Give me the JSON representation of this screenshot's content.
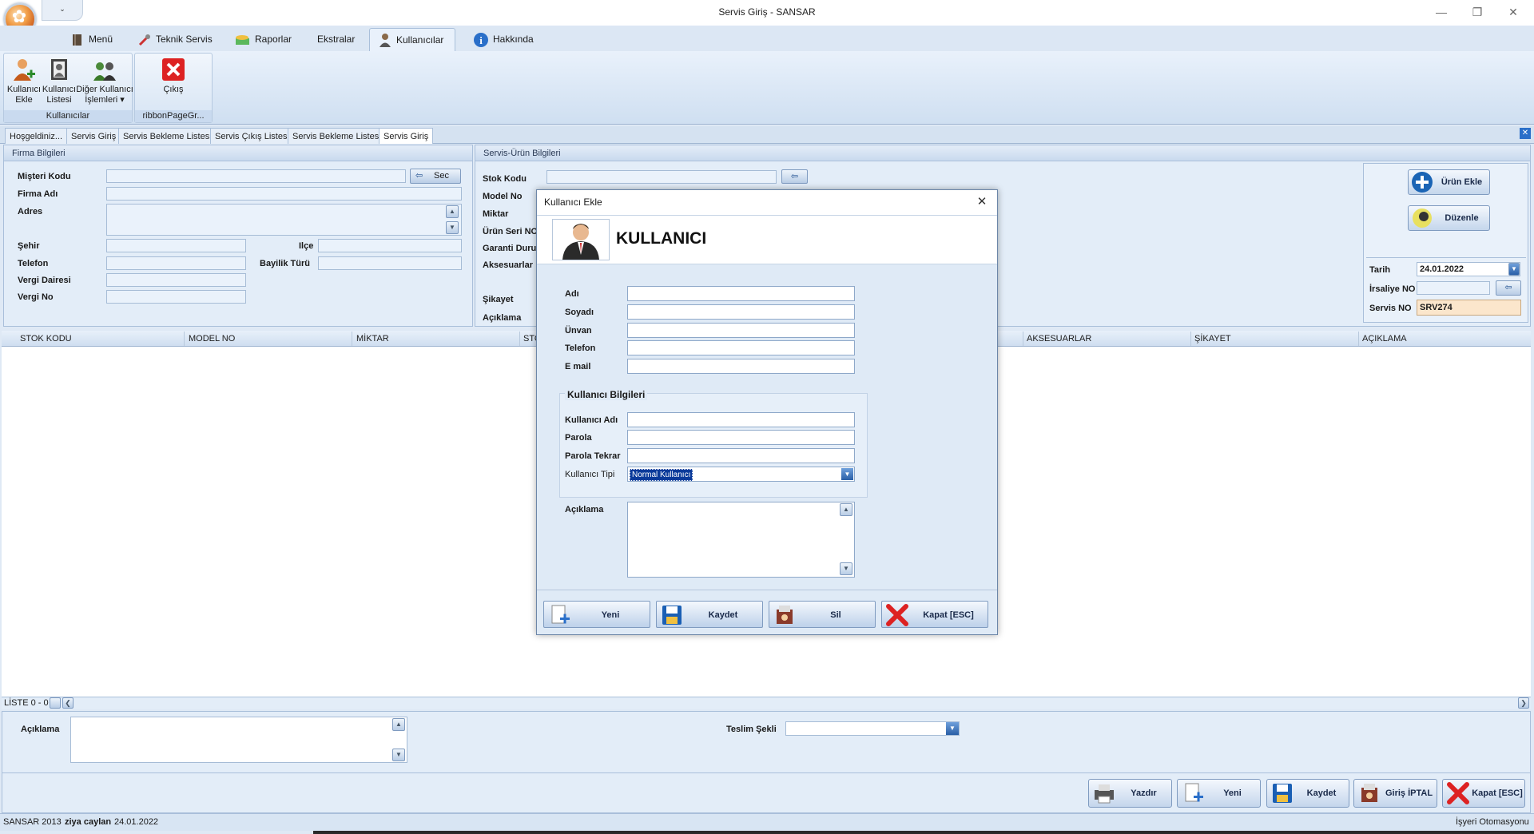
{
  "window": {
    "title": "Servis Giriş - SANSAR",
    "qat_label": "⌄"
  },
  "tabs": [
    {
      "label": "Menü",
      "icon": "book-icon"
    },
    {
      "label": "Teknik Servis",
      "icon": "tools-icon"
    },
    {
      "label": "Raporlar",
      "icon": "money-icon"
    },
    {
      "label": "Ekstralar",
      "icon": ""
    },
    {
      "label": "Kullanıcılar",
      "icon": "user-icon",
      "active": true
    },
    {
      "label": "Hakkında",
      "icon": "info-icon"
    }
  ],
  "ribbon": {
    "group1": {
      "label": "Kullanıcılar",
      "buttons": [
        {
          "line1": "Kullanıcı",
          "line2": "Ekle"
        },
        {
          "line1": "Kullanıcı",
          "line2": "Listesi"
        },
        {
          "line1": "Diğer Kullanıcı",
          "line2": "İşlemleri ▾"
        }
      ]
    },
    "group2": {
      "label": "ribbonPageGr...",
      "buttons": [
        {
          "line1": "Çıkış"
        }
      ]
    }
  },
  "doc_tabs": [
    "Hoşgeldiniz...",
    "Servis Giriş",
    "Servis Bekleme Listesi",
    "Servis Çıkış Listesi",
    "Servis Bekleme Listesi",
    "Servis Giriş"
  ],
  "firma": {
    "header": "Firma Bilgileri",
    "musteri_kodu": "Mişteri Kodu",
    "sec_button": "Sec",
    "firma_adi": "Firma Adı",
    "adres": "Adres",
    "sehir": "Şehir",
    "ilce": "Ilçe",
    "telefon": "Telefon",
    "bayilik_turu": "Bayilik Türü",
    "vergi_dairesi": "Vergi Dairesi",
    "vergi_no": "Vergi No"
  },
  "urun": {
    "header": "Servis-Ürün Bilgileri",
    "stok_kodu": "Stok Kodu",
    "model_no": "Model No",
    "miktar": "Miktar",
    "urun_seri_no": "Ürün Seri NO",
    "garanti": "Garanti Durum",
    "aksesuarlar": "Aksesuarlar",
    "sikayet": "Şikayet",
    "aciklama": "Açıklama"
  },
  "side": {
    "urun_ekle": "Ürün Ekle",
    "duzenle": "Düzenle",
    "tarih_label": "Tarih",
    "tarih_value": "24.01.2022",
    "irsaliye_label": "İrsaliye NO",
    "servis_label": "Servis NO",
    "servis_value": "SRV274"
  },
  "grid": {
    "columns": [
      "STOK KODU",
      "MODEL NO",
      "MİKTAR",
      "STO",
      "AKSESUARLAR",
      "ŞİKAYET",
      "AÇIKLAMA"
    ],
    "list_status": "LİSTE 0 - 0"
  },
  "bottom": {
    "aciklama": "Açıklama",
    "teslim": "Teslim Şekli",
    "buttons": [
      "Yazdır",
      "Yeni",
      "Kaydet",
      "Giriş İPTAL",
      "Kapat [ESC]"
    ]
  },
  "status": {
    "app": "SANSAR 2013",
    "user": "ziya caylan",
    "date": "24.01.2022",
    "right": "İşyeri Otomasyonu"
  },
  "dialog": {
    "title": "Kullanıcı Ekle",
    "heading": "KULLANICI",
    "fields": {
      "adi": "Adı",
      "soyadi": "Soyadı",
      "unvan": "Ünvan",
      "telefon": "Telefon",
      "email": "E mail"
    },
    "group_title": "Kullanıcı Bilgileri",
    "kullanici_adi": "Kullanıcı Adı",
    "parola": "Parola",
    "parola_tekrar": "Parola Tekrar",
    "kullanici_tipi": "Kullanıcı Tipi",
    "kullanici_tipi_value": "Normal Kullanıcı",
    "aciklama": "Açıklama",
    "buttons": {
      "yeni": "Yeni",
      "kaydet": "Kaydet",
      "sil": "Sil",
      "kapat": "Kapat [ESC]"
    }
  }
}
